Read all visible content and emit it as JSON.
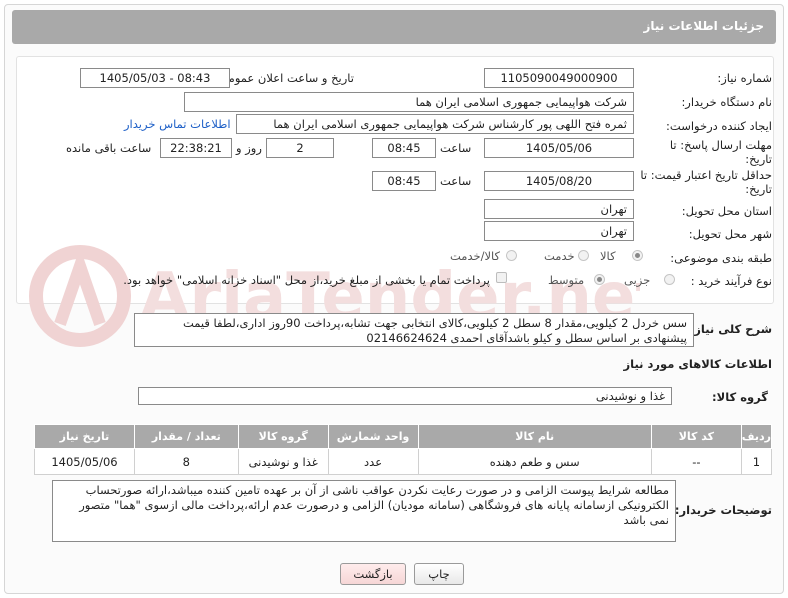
{
  "header": {
    "title": "جزئیات اطلاعات نیاز"
  },
  "form": {
    "need_number": {
      "label": "شماره نیاز:",
      "value": "1105090049000900"
    },
    "announce_datetime": {
      "label": "تاریخ و ساعت اعلان عمومی:",
      "value": "1405/05/03 - 08:43"
    },
    "buyer_org": {
      "label": "نام دستگاه خریدار:",
      "value": "شرکت هواپیمایی جمهوری اسلامی ایران هما"
    },
    "requester": {
      "label": "ایجاد کننده درخواست:",
      "value": "ثمره فتح اللهی پور کارشناس شرکت هواپیمایی جمهوری اسلامی ایران هما",
      "contact_link": "اطلاعات تماس خریدار"
    },
    "reply_deadline": {
      "label": "مهلت ارسال پاسخ: تا تاریخ:",
      "date": "1405/05/06",
      "time_label": "ساعت",
      "time": "08:45",
      "days": "2",
      "days_label": "روز و",
      "remaining": "22:38:21",
      "remaining_label": "ساعت باقی مانده"
    },
    "price_validity": {
      "label": "حداقل تاریخ اعتبار قیمت: تا تاریخ:",
      "date": "1405/08/20",
      "time_label": "ساعت",
      "time": "08:45"
    },
    "delivery_province": {
      "label": "استان محل تحویل:",
      "value": "تهران"
    },
    "delivery_city": {
      "label": "شهر محل تحویل:",
      "value": "تهران"
    },
    "category": {
      "label": "طبقه بندی موضوعی:",
      "options": [
        "کالا",
        "خدمت",
        "کالا/خدمت"
      ],
      "selected": "کالا"
    },
    "process_type": {
      "label": "نوع فرآیند خرید :",
      "options": [
        "جزیی",
        "متوسط"
      ],
      "selected": "متوسط",
      "payment_note": "پرداخت تمام یا بخشی از مبلغ خرید،از محل \"اسناد خزانه اسلامی\" خواهد بود."
    }
  },
  "description": {
    "label": "شرح کلی نیاز:",
    "text": "سس خردل 2 کیلویی،مقدار 8 سطل 2 کیلویی،کالای انتخابی جهت تشابه،پرداخت 90روز اداری،لطفا قیمت پیشنهادی بر اساس سطل و کیلو باشدآقای احمدی 02146624624"
  },
  "goods_section": {
    "title": "اطلاعات کالاهای مورد نیاز",
    "group_label": "گروه کالا:",
    "group_value": "غذا و نوشیدنی"
  },
  "table": {
    "headers": [
      "ردیف",
      "کد کالا",
      "نام کالا",
      "واحد شمارش",
      "گروه کالا",
      "تعداد / مقدار",
      "تاریخ نیاز"
    ],
    "rows": [
      [
        "1",
        "--",
        "سس و طعم دهنده",
        "عدد",
        "غذا و نوشیدنی",
        "8",
        "1405/05/06"
      ]
    ]
  },
  "buyer_notes": {
    "label": "توضیحات خریدار:",
    "text": "مطالعه شرایط پیوست الزامی و در صورت رعایت نکردن عواقب ناشی از آن بر عهده تامین کننده میباشد،ارائه صورتحساب الکترونیکی ازسامانه پایانه های فروشگاهی (سامانه مودیان) الزامی و درصورت عدم ارائه،پرداخت مالی ازسوی \"هما\" متصور نمی باشد"
  },
  "buttons": {
    "print": "چاپ",
    "back": "بازگشت"
  },
  "watermark": {
    "text": "AriaTender.net"
  },
  "colors": {
    "header_bg": "#a9a9a9",
    "link": "#1d5fc7",
    "watermark": "#f0d3d3"
  }
}
